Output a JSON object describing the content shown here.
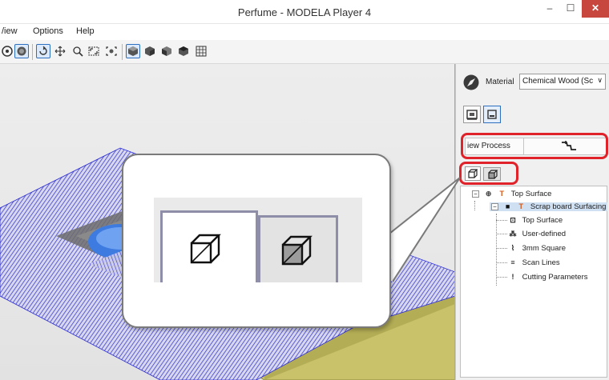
{
  "window": {
    "title": "Perfume - MODELA Player 4",
    "minimize": "–",
    "maximize": "☐",
    "close": "✕"
  },
  "menu": [
    {
      "label": "View",
      "shown": "/iew"
    },
    {
      "label": "Options"
    },
    {
      "label": "Help"
    }
  ],
  "toolbar": {
    "buttons": [
      "orbit-icon",
      "solid-icon",
      "rotate-icon",
      "pan-icon",
      "zoom-icon",
      "zoom-window-icon",
      "fit-icon",
      "view-iso-icon",
      "view-front-icon",
      "view-side-icon",
      "view-top-icon",
      "view-grid-icon"
    ]
  },
  "panel": {
    "material_label": "Material",
    "material_value": "Chemical Wood (Sc",
    "process_label": "New Process",
    "process_label_shown": "iew Process",
    "tree": [
      {
        "label": "Top Surface",
        "level": 0,
        "icon": "surface-icon"
      },
      {
        "label": "Scrap board Surfacing",
        "level": 1,
        "icon": "process-icon",
        "selected": true
      },
      {
        "label": "Top Surface",
        "level": 2,
        "icon": "surface-icon"
      },
      {
        "label": "User-defined",
        "level": 2,
        "icon": "user-defined-icon"
      },
      {
        "label": "3mm Square",
        "level": 2,
        "icon": "tool-icon"
      },
      {
        "label": "Scan Lines",
        "level": 2,
        "icon": "scan-lines-icon"
      },
      {
        "label": "Cutting Parameters",
        "level": 2,
        "icon": "cutting-params-icon"
      }
    ]
  },
  "colors": {
    "accent_blue": "#2f6fbf",
    "highlight_red": "#e0222a",
    "toolpath_blue": "#2a2ad0",
    "model_blue": "#3d7be0",
    "stock_yellow": "#c9c26a"
  }
}
